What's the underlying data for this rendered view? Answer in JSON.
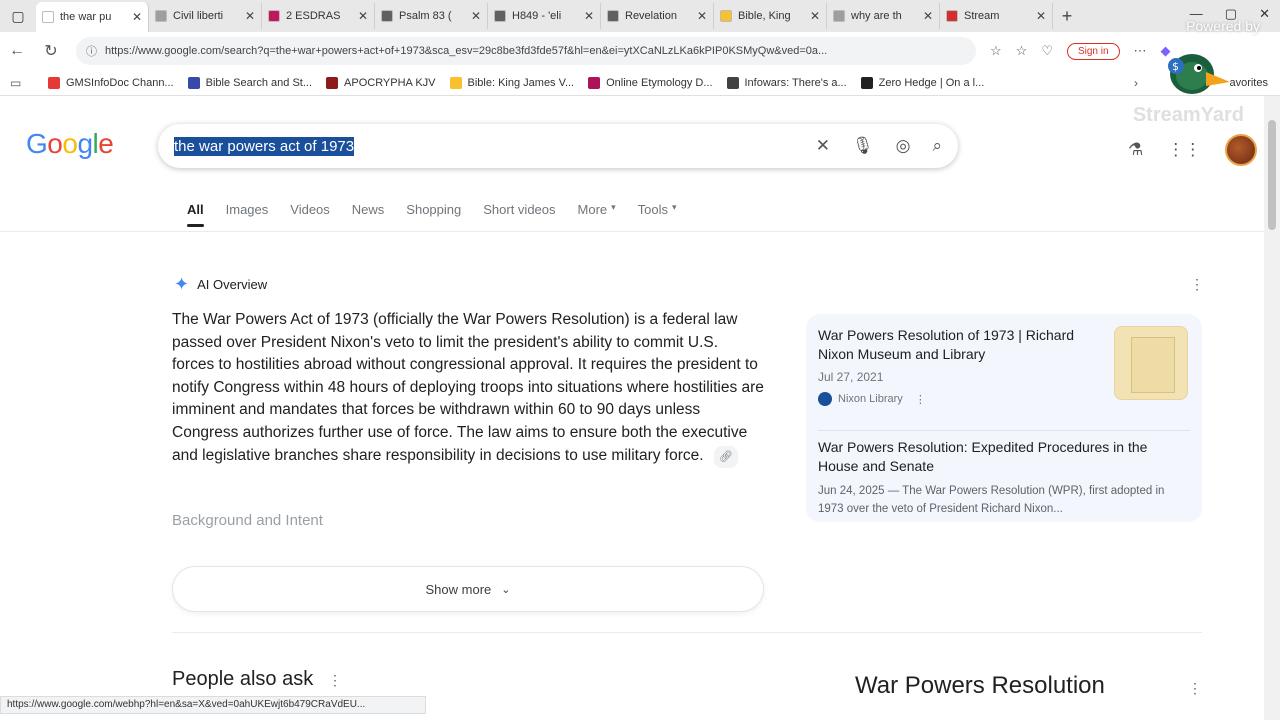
{
  "browser": {
    "tabs": [
      {
        "title": "the war pu",
        "color": "#ffffff",
        "active": true
      },
      {
        "title": "Civil liberti",
        "color": "#9e9e9e"
      },
      {
        "title": "2 ESDRAS",
        "color": "#c2185b"
      },
      {
        "title": "Psalm 83 (",
        "color": "#616161"
      },
      {
        "title": "H849 - 'eli",
        "color": "#616161"
      },
      {
        "title": "Revelation",
        "color": "#616161"
      },
      {
        "title": "Bible, King",
        "color": "#fbc02d"
      },
      {
        "title": "why are th",
        "color": "#9e9e9e"
      },
      {
        "title": "Stream",
        "color": "#d32f2f"
      }
    ],
    "url": "https://www.google.com/search?q=the+war+powers+act+of+1973&sca_esv=29c8be3fd3fde57f&hl=en&ei=ytXCaNLzLKa6kPIP0KSMyQw&ved=0a...",
    "sign_in": "Sign in",
    "bookmarks": [
      {
        "label": "GMSInfoDoc Chann...",
        "color": "#e53935"
      },
      {
        "label": "Bible Search and St...",
        "color": "#3949ab"
      },
      {
        "label": "APOCRYPHA KJV",
        "color": "#8e1b1b"
      },
      {
        "label": "Bible: King James V...",
        "color": "#fbc02d"
      },
      {
        "label": "Online Etymology D...",
        "color": "#ad1457"
      },
      {
        "label": "Infowars: There's a...",
        "color": "#424242"
      },
      {
        "label": "Zero Hedge | On a l...",
        "color": "#212121"
      }
    ],
    "bookmarks_more": "avorites",
    "status_bar_url": "https://www.google.com/webhp?hl=en&sa=X&ved=0ahUKEwjt6b479CRaVdEU..."
  },
  "overlay": {
    "powered": "Powered by",
    "streamyard": "StreamYard"
  },
  "search": {
    "logo": "Google",
    "query": "the war powers act of 1973",
    "filters": [
      "All",
      "Images",
      "Videos",
      "News",
      "Shopping",
      "Short videos",
      "More",
      "Tools"
    ]
  },
  "ai_overview": {
    "label": "AI Overview",
    "text": "The War Powers Act of 1973 (officially the War Powers Resolution) is a federal law passed over President Nixon's veto to limit the president's ability to commit U.S. forces to hostilities abroad without congressional approval. It requires the president to notify Congress within 48 hours of deploying troops into situations where hostilities are imminent and mandates that forces be withdrawn within 60 to 90 days unless Congress authorizes further use of force. The law aims to ensure both the executive and legislative branches share responsibility in decisions to use military force.",
    "subheading": "Background and Intent",
    "show_more": "Show more",
    "sources": [
      {
        "title": "War Powers Resolution of 1973 | Richard Nixon Museum and Library",
        "date": "Jul 27, 2021",
        "site": "Nixon Library"
      },
      {
        "title": "War Powers Resolution: Expedited Procedures in the House and Senate",
        "snippet": "Jun 24, 2025 — The War Powers Resolution (WPR), first adopted in 1973 over the veto of President Richard Nixon..."
      }
    ]
  },
  "people_also_ask": "People also ask",
  "knowledge_panel_title": "War Powers Resolution"
}
